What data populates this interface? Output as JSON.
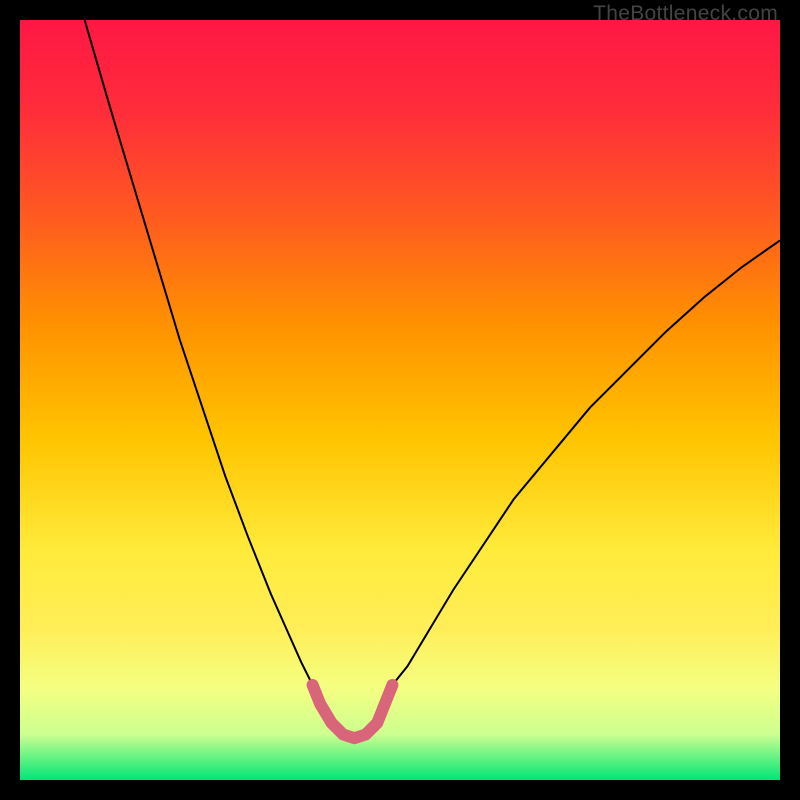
{
  "watermark": "TheBottleneck.com",
  "chart_data": {
    "type": "line",
    "title": "",
    "xlabel": "",
    "ylabel": "",
    "xlim": [
      0,
      100
    ],
    "ylim": [
      0,
      100
    ],
    "gradient_stops": [
      {
        "offset": 0,
        "color": "#ff1744"
      },
      {
        "offset": 12,
        "color": "#ff2d3a"
      },
      {
        "offset": 25,
        "color": "#ff5722"
      },
      {
        "offset": 40,
        "color": "#ff9100"
      },
      {
        "offset": 55,
        "color": "#ffc400"
      },
      {
        "offset": 70,
        "color": "#ffeb3b"
      },
      {
        "offset": 80,
        "color": "#ffee58"
      },
      {
        "offset": 88,
        "color": "#f4ff81"
      },
      {
        "offset": 94,
        "color": "#ccff90"
      },
      {
        "offset": 100,
        "color": "#00e676"
      }
    ],
    "series": [
      {
        "name": "left-curve",
        "stroke": "#000",
        "stroke_width": 2,
        "points": [
          {
            "x": 8.5,
            "y": 100
          },
          {
            "x": 12,
            "y": 88
          },
          {
            "x": 15,
            "y": 78
          },
          {
            "x": 18,
            "y": 68
          },
          {
            "x": 21,
            "y": 58
          },
          {
            "x": 24,
            "y": 49
          },
          {
            "x": 27,
            "y": 40
          },
          {
            "x": 30,
            "y": 32
          },
          {
            "x": 33,
            "y": 24.5
          },
          {
            "x": 35,
            "y": 20
          },
          {
            "x": 37,
            "y": 15.5
          },
          {
            "x": 38.5,
            "y": 12.5
          }
        ]
      },
      {
        "name": "right-curve",
        "stroke": "#000",
        "stroke_width": 2,
        "points": [
          {
            "x": 49,
            "y": 12.5
          },
          {
            "x": 51,
            "y": 15
          },
          {
            "x": 54,
            "y": 20
          },
          {
            "x": 57,
            "y": 25
          },
          {
            "x": 61,
            "y": 31
          },
          {
            "x": 65,
            "y": 37
          },
          {
            "x": 70,
            "y": 43
          },
          {
            "x": 75,
            "y": 49
          },
          {
            "x": 80,
            "y": 54
          },
          {
            "x": 85,
            "y": 59
          },
          {
            "x": 90,
            "y": 63.5
          },
          {
            "x": 95,
            "y": 67.5
          },
          {
            "x": 100,
            "y": 71
          }
        ]
      },
      {
        "name": "bottom-highlight",
        "stroke": "#d9657a",
        "stroke_width": 12,
        "linecap": "round",
        "points": [
          {
            "x": 38.5,
            "y": 12.5
          },
          {
            "x": 39.5,
            "y": 10
          },
          {
            "x": 41,
            "y": 7.5
          },
          {
            "x": 42.5,
            "y": 6
          },
          {
            "x": 44,
            "y": 5.5
          },
          {
            "x": 45.5,
            "y": 6
          },
          {
            "x": 47,
            "y": 7.5
          },
          {
            "x": 48,
            "y": 10
          },
          {
            "x": 49,
            "y": 12.5
          }
        ]
      }
    ]
  }
}
